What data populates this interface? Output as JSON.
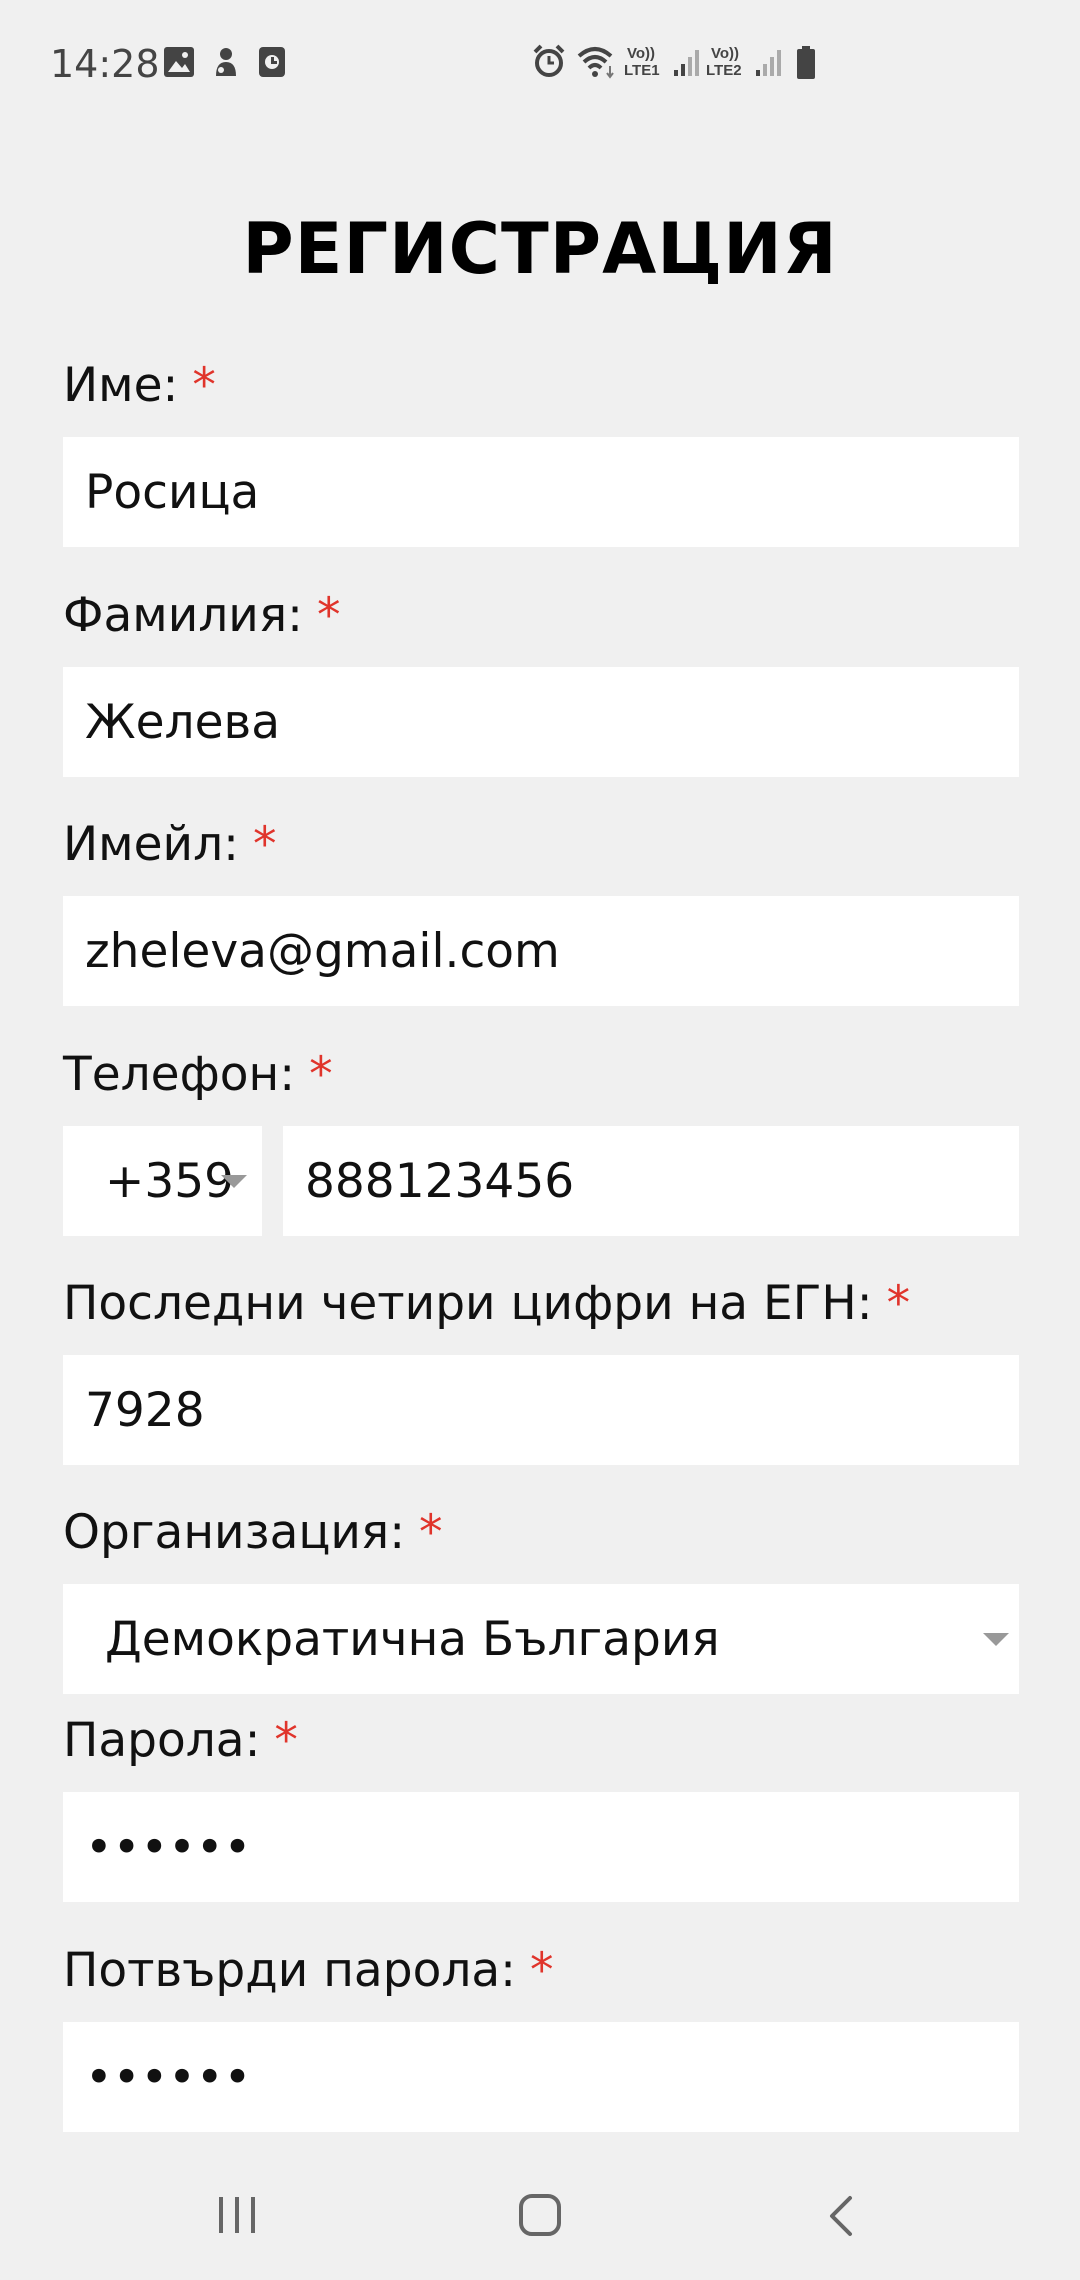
{
  "status_bar": {
    "time": "14:28",
    "sim1_label": "LTE1",
    "sim2_label": "LTE2",
    "volte1": "Vo))",
    "volte2": "Vo))",
    "left_icons": [
      "image-icon",
      "notification-icon",
      "screen-recorder-icon"
    ],
    "right_icons": [
      "alarm-icon",
      "wifi-icon",
      "signal-sim1-icon",
      "signal-sim2-icon",
      "battery-icon"
    ]
  },
  "title": "РЕГИСТРАЦИЯ",
  "required_mark": "*",
  "form": {
    "first_name": {
      "label": "Име:",
      "value": "Росица"
    },
    "last_name": {
      "label": "Фамилия:",
      "value": "Желева"
    },
    "email": {
      "label": "Имейл:",
      "value": "zheleva@gmail.com"
    },
    "phone": {
      "label": "Телефон:",
      "country_code": "+359",
      "value": "888123456"
    },
    "egn_last_four": {
      "label": "Последни четири цифри на ЕГН:",
      "value": "7928"
    },
    "organization": {
      "label": "Организация:",
      "selected": "Демократична България"
    },
    "password": {
      "label": "Парола:",
      "value": "••••••"
    },
    "confirm_password": {
      "label": "Потвърди парола:",
      "value": "••••••"
    }
  },
  "nav_bar": {
    "icons": [
      "recent-apps-icon",
      "home-icon",
      "back-icon"
    ]
  },
  "colors": {
    "background": "#f0f0f0",
    "input_bg": "#ffffff",
    "required": "#e0342b"
  }
}
